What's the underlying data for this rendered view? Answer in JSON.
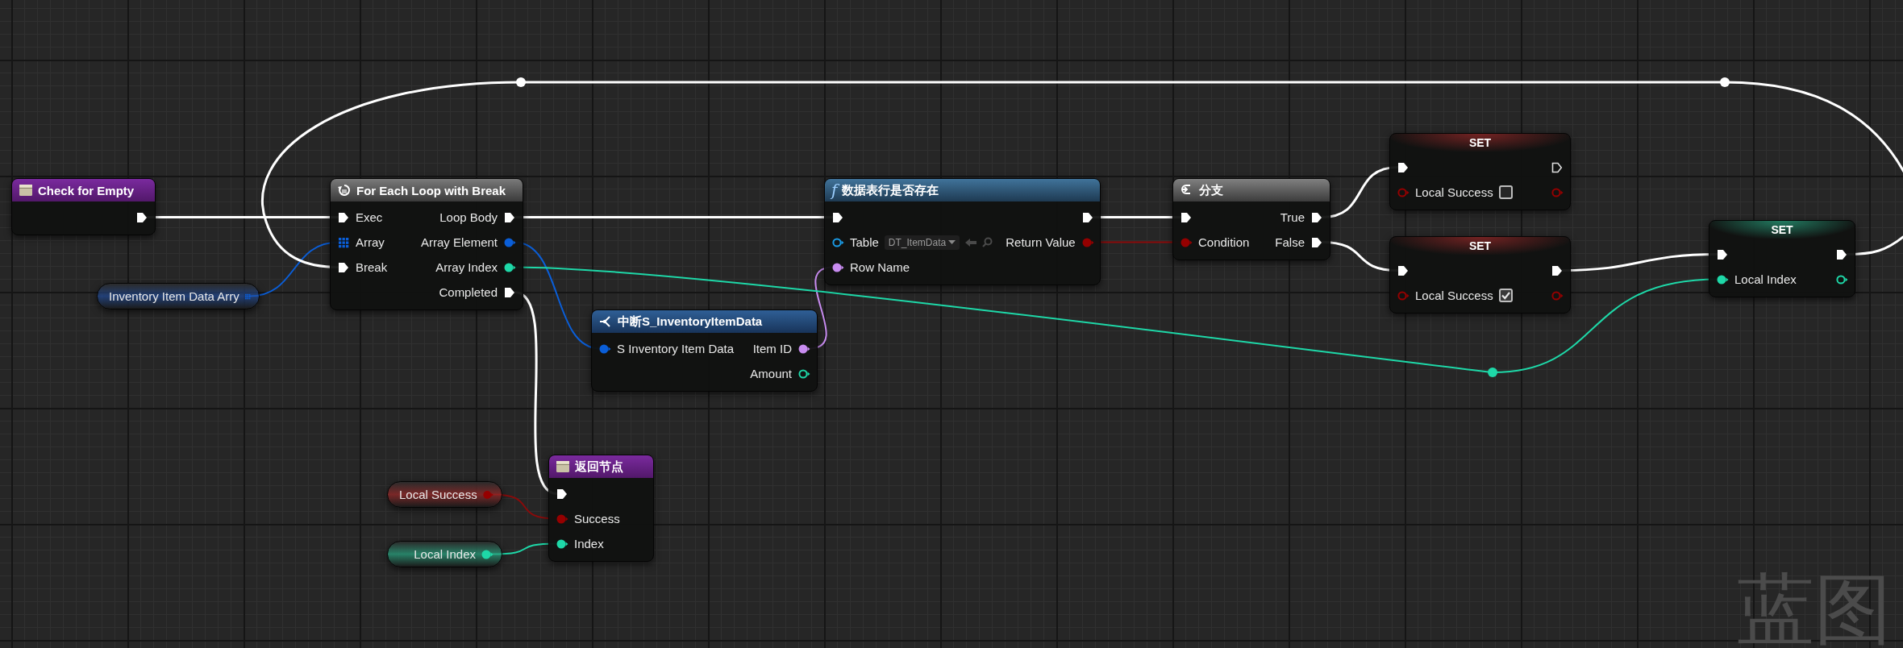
{
  "graph": {
    "type_label": "蓝图",
    "nodes": [
      {
        "kind": "event",
        "title": "Check for Empty",
        "outputs": [
          {
            "kind": "exec",
            "connected": true
          }
        ]
      },
      {
        "kind": "variable",
        "title": "Inventory Item Data Arry",
        "outputs": [
          {
            "kind": "array",
            "connected": true
          }
        ]
      },
      {
        "kind": "macro",
        "title": "For Each Loop with Break",
        "inputs": [
          {
            "label": "Exec",
            "kind": "exec",
            "connected": true
          },
          {
            "label": "Array",
            "kind": "array",
            "connected": true
          },
          {
            "label": "Break",
            "kind": "exec",
            "connected": true
          }
        ],
        "outputs": [
          {
            "label": "Loop Body",
            "kind": "exec",
            "connected": true
          },
          {
            "label": "Array Element",
            "kind": "struct",
            "connected": true
          },
          {
            "label": "Array Index",
            "kind": "int",
            "connected": true
          },
          {
            "label": "Completed",
            "kind": "exec",
            "connected": true
          }
        ]
      },
      {
        "kind": "variable",
        "title": "Local Success",
        "outputs": [
          {
            "kind": "bool",
            "connected": true
          }
        ]
      },
      {
        "kind": "variable",
        "title": "Local Index",
        "outputs": [
          {
            "kind": "int",
            "connected": true
          }
        ]
      },
      {
        "kind": "event",
        "title": "返回节点",
        "inputs": [
          {
            "kind": "exec",
            "connected": true
          },
          {
            "label": "Success",
            "kind": "bool",
            "connected": true
          },
          {
            "label": "Index",
            "kind": "int",
            "connected": true
          }
        ]
      },
      {
        "kind": "break",
        "title": "中断S_InventoryItemData",
        "inputs": [
          {
            "label": "S Inventory Item Data",
            "kind": "struct",
            "connected": true
          }
        ],
        "outputs": [
          {
            "label": "Item ID",
            "kind": "name",
            "connected": true
          },
          {
            "label": "Amount",
            "kind": "int",
            "connected": false
          }
        ]
      },
      {
        "kind": "function",
        "glyph": "f",
        "title": "数据表行是否存在",
        "inputs": [
          {
            "kind": "exec",
            "connected": true
          },
          {
            "label": "Table",
            "kind": "table",
            "connected": false,
            "value": "DT_ItemData"
          },
          {
            "label": "Row Name",
            "kind": "name",
            "connected": true
          }
        ],
        "outputs": [
          {
            "kind": "exec",
            "connected": true
          },
          {
            "label": "Return Value",
            "kind": "bool",
            "connected": true
          }
        ]
      },
      {
        "kind": "branch",
        "title": "分支",
        "inputs": [
          {
            "kind": "exec",
            "connected": true
          },
          {
            "label": "Condition",
            "kind": "bool",
            "connected": true
          }
        ],
        "outputs": [
          {
            "label": "True",
            "kind": "exec",
            "connected": true
          },
          {
            "label": "False",
            "kind": "exec",
            "connected": true
          }
        ]
      },
      {
        "kind": "set",
        "title": "SET",
        "inputs": [
          {
            "kind": "exec",
            "connected": true
          },
          {
            "label": "Local Success",
            "kind": "bool",
            "connected": false,
            "checked": false
          }
        ],
        "outputs": [
          {
            "kind": "exec",
            "connected": false
          },
          {
            "kind": "bool",
            "connected": false
          }
        ]
      },
      {
        "kind": "set",
        "title": "SET",
        "inputs": [
          {
            "kind": "exec",
            "connected": true
          },
          {
            "label": "Local Success",
            "kind": "bool",
            "connected": false,
            "checked": true
          }
        ],
        "outputs": [
          {
            "kind": "exec",
            "connected": true
          },
          {
            "kind": "bool",
            "connected": false
          }
        ]
      },
      {
        "kind": "set",
        "title": "SET",
        "inputs": [
          {
            "kind": "exec",
            "connected": true
          },
          {
            "label": "Local Index",
            "kind": "int",
            "connected": true
          }
        ],
        "outputs": [
          {
            "kind": "exec",
            "connected": true
          },
          {
            "kind": "int",
            "connected": false
          }
        ]
      }
    ]
  }
}
